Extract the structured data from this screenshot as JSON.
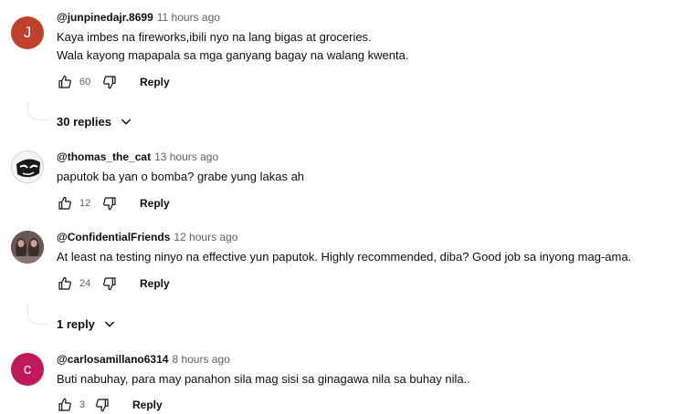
{
  "comments": [
    {
      "author": "@junpinedajr.8699",
      "time": "11 hours ago",
      "avatar_letter": "J",
      "avatar_color": "#c0412b",
      "lines": [
        "Kaya imbes na fireworks,ibili nyo na lang bigas at groceries.",
        "Wala kayong mapapala sa mga ganyang bagay na walang kwenta."
      ],
      "likes": "60",
      "reply_label": "Reply",
      "replies_label": "30 replies"
    },
    {
      "author": "@thomas_the_cat",
      "time": "13 hours ago",
      "lines": [
        "paputok ba yan o bomba? grabe yung lakas ah"
      ],
      "likes": "12",
      "reply_label": "Reply"
    },
    {
      "author": "@ConfidentialFriends",
      "time": "12 hours ago",
      "lines": [
        "At least na testing ninyo na effective yun paputok. Highly recommended, diba? Good job sa inyong mag-ama."
      ],
      "likes": "24",
      "reply_label": "Reply",
      "replies_label": "1 reply"
    },
    {
      "author": "@carlosamillano6314",
      "time": "8 hours ago",
      "avatar_letter": "c",
      "avatar_color": "#c2185b",
      "lines": [
        "Buti nabuhay, para may panahon sila mag sisi sa ginagawa nila sa buhay nila.."
      ],
      "likes": "3",
      "reply_label": "Reply"
    }
  ]
}
